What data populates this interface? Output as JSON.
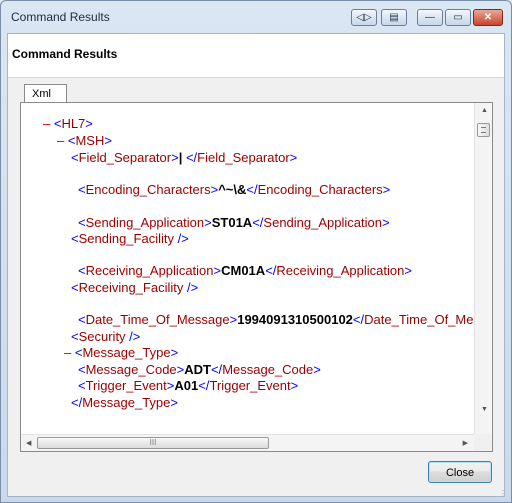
{
  "window": {
    "title": "Command Results",
    "buttons": [
      "◁▷",
      "▤",
      "—",
      "▭",
      "✕"
    ]
  },
  "header": {
    "title": "Command Results"
  },
  "tabs": [
    {
      "label": "Xml"
    }
  ],
  "xml_lines": [
    {
      "indent": 0,
      "collapse": "–",
      "parts": [
        [
          "br",
          "<"
        ],
        [
          "tg",
          "HL7"
        ],
        [
          "br",
          ">"
        ]
      ]
    },
    {
      "indent": 1,
      "collapse": "–",
      "parts": [
        [
          "br",
          "<"
        ],
        [
          "tg",
          "MSH"
        ],
        [
          "br",
          ">"
        ]
      ]
    },
    {
      "indent": 2,
      "collapse": "",
      "parts": [
        [
          "br",
          "<"
        ],
        [
          "tg",
          "Field_Separator"
        ],
        [
          "br",
          ">"
        ],
        [
          "val",
          "|"
        ],
        [
          "br",
          " </"
        ],
        [
          "tg",
          "Field_Separator"
        ],
        [
          "br",
          ">"
        ]
      ]
    },
    {
      "indent": 2.5,
      "collapse": "",
      "parts": [
        [
          "br",
          "<"
        ],
        [
          "tg",
          "Encoding_Characters"
        ],
        [
          "br",
          ">"
        ],
        [
          "val",
          "^~\\&"
        ],
        [
          "br",
          "</"
        ],
        [
          "tg",
          "Encoding_Characters"
        ],
        [
          "br",
          ">"
        ]
      ]
    },
    {
      "indent": 2.5,
      "collapse": "",
      "parts": [
        [
          "br",
          "<"
        ],
        [
          "tg",
          "Sending_Application"
        ],
        [
          "br",
          ">"
        ],
        [
          "val",
          "ST01A"
        ],
        [
          "br",
          "</"
        ],
        [
          "tg",
          "Sending_Application"
        ],
        [
          "br",
          ">"
        ]
      ]
    },
    {
      "indent": 2,
      "collapse": "",
      "parts": [
        [
          "br",
          "<"
        ],
        [
          "tg",
          "Sending_Facility"
        ],
        [
          "br",
          " />"
        ]
      ]
    },
    {
      "indent": 2.5,
      "collapse": "",
      "parts": [
        [
          "br",
          "<"
        ],
        [
          "tg",
          "Receiving_Application"
        ],
        [
          "br",
          ">"
        ],
        [
          "val",
          "CM01A"
        ],
        [
          "br",
          "</"
        ],
        [
          "tg",
          "Receiving_Application"
        ],
        [
          "br",
          ">"
        ]
      ]
    },
    {
      "indent": 2,
      "collapse": "",
      "parts": [
        [
          "br",
          "<"
        ],
        [
          "tg",
          "Receiving_Facility"
        ],
        [
          "br",
          " />"
        ]
      ]
    },
    {
      "indent": 2.5,
      "collapse": "",
      "parts": [
        [
          "br",
          "<"
        ],
        [
          "tg",
          "Date_Time_Of_Message"
        ],
        [
          "br",
          ">"
        ],
        [
          "val",
          "1994091310500102"
        ],
        [
          "br",
          "</"
        ],
        [
          "tg",
          "Date_Time_Of_Message"
        ],
        [
          "br",
          ">"
        ]
      ]
    },
    {
      "indent": 2,
      "collapse": "",
      "parts": [
        [
          "br",
          "<"
        ],
        [
          "tg",
          "Security"
        ],
        [
          "br",
          " />"
        ]
      ]
    },
    {
      "indent": 1.5,
      "collapse": "–",
      "parts": [
        [
          "br",
          "<"
        ],
        [
          "tg",
          "Message_Type"
        ],
        [
          "br",
          ">"
        ]
      ]
    },
    {
      "indent": 2.5,
      "collapse": "",
      "parts": [
        [
          "br",
          "<"
        ],
        [
          "tg",
          "Message_Code"
        ],
        [
          "br",
          ">"
        ],
        [
          "val",
          "ADT"
        ],
        [
          "br",
          "</"
        ],
        [
          "tg",
          "Message_Code"
        ],
        [
          "br",
          ">"
        ]
      ]
    },
    {
      "indent": 2.5,
      "collapse": "",
      "parts": [
        [
          "br",
          "<"
        ],
        [
          "tg",
          "Trigger_Event"
        ],
        [
          "br",
          ">"
        ],
        [
          "val",
          "A01"
        ],
        [
          "br",
          "</"
        ],
        [
          "tg",
          "Trigger_Event"
        ],
        [
          "br",
          ">"
        ]
      ]
    },
    {
      "indent": 2,
      "collapse": "",
      "parts": [
        [
          "br",
          "</"
        ],
        [
          "tg",
          "Message_Type"
        ],
        [
          "br",
          ">"
        ]
      ]
    }
  ],
  "scrollbar": {
    "h_grip": "III"
  },
  "footer": {
    "close_label": "Close"
  }
}
